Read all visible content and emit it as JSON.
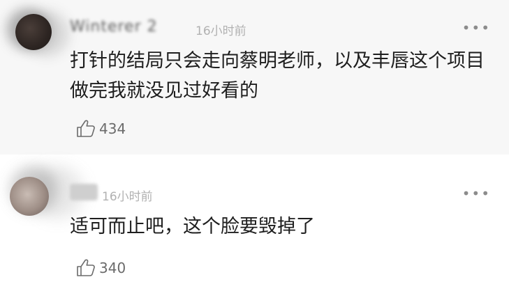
{
  "comments": [
    {
      "username": "Winterer 2",
      "time": "16小时前",
      "text": "打针的结局只会走向蔡明老师，以及丰唇这个项目做完我就没见过好看的",
      "likes": "434",
      "more_icon": "more-dots-icon"
    },
    {
      "username": "",
      "time": "16小时前",
      "text": "适可而止吧，这个脸要毁掉了",
      "likes": "340",
      "more_icon": "more-dots-icon"
    }
  ],
  "icons": {
    "like": "thumbs-up-icon",
    "more": "more-dots-icon"
  },
  "colors": {
    "text": "#1e1e1e",
    "meta": "#b1b1b1",
    "highlight_bg": "#f7f7f7"
  }
}
